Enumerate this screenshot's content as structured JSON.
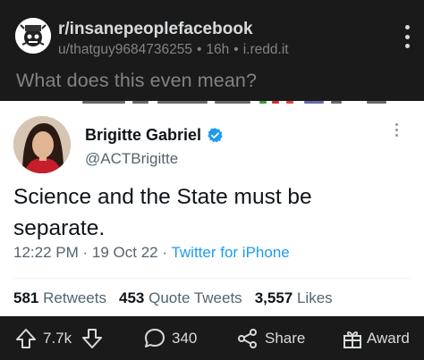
{
  "post": {
    "subreddit": "r/insanepeoplefacebook",
    "author": "u/thatguy9684736255",
    "age": "16h",
    "domain": "i.redd.it",
    "separator": "•",
    "title": "What does this even mean?"
  },
  "tweet": {
    "display_name": "Brigitte Gabriel",
    "handle": "@ACTBrigitte",
    "text": "Science and the State must be separate.",
    "time": "12:22 PM",
    "date": "19 Oct 22",
    "source": "Twitter for iPhone",
    "dot": "·",
    "stats": [
      {
        "count": "581",
        "label": "Retweets"
      },
      {
        "count": "453",
        "label": "Quote Tweets"
      },
      {
        "count": "3,557",
        "label": "Likes"
      }
    ],
    "colors": {
      "link": "#1d9bf0",
      "verified": "#1d9bf0",
      "text": "#0f1419",
      "muted": "#536471"
    }
  },
  "actions": {
    "score": "7.7k",
    "comments": "340",
    "share_label": "Share",
    "award_label": "Award",
    "icons": [
      "upvote-icon",
      "downvote-icon",
      "comment-icon",
      "share-icon",
      "award-icon"
    ]
  },
  "colors": {
    "header_bg": "#1a1a1b",
    "primary_text": "#d7dadc",
    "muted_text": "#818384"
  }
}
